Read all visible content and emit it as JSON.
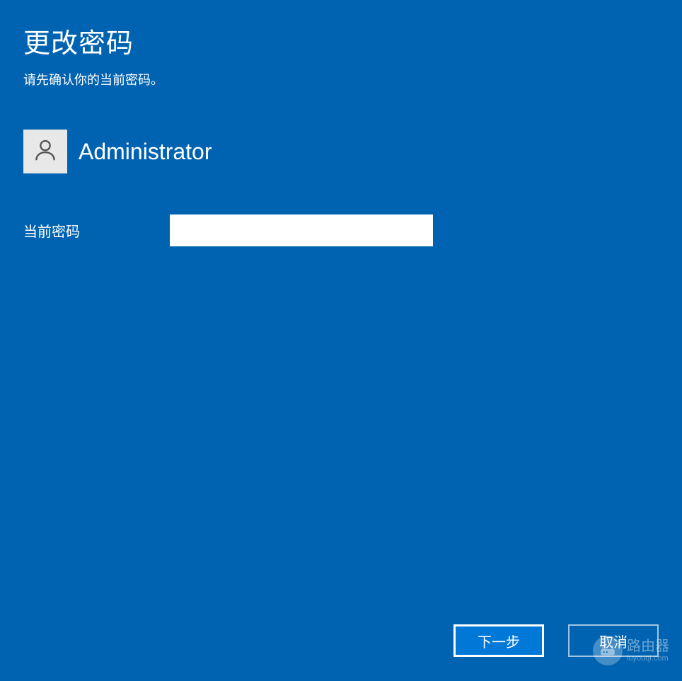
{
  "header": {
    "title": "更改密码",
    "subtitle": "请先确认你的当前密码。"
  },
  "user": {
    "name": "Administrator"
  },
  "form": {
    "current_password_label": "当前密码",
    "current_password_value": ""
  },
  "buttons": {
    "next": "下一步",
    "cancel": "取消"
  },
  "watermark": {
    "title": "路由器",
    "sub": "luyouqi.com"
  }
}
